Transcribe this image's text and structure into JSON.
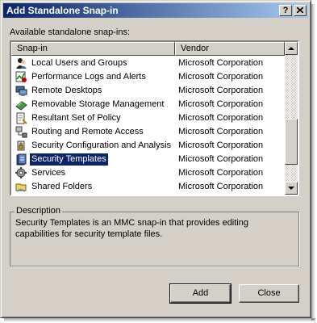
{
  "window": {
    "title": "Add Standalone Snap-in",
    "help_label": "?",
    "close_label": "✕"
  },
  "list": {
    "label": "Available standalone snap-ins:",
    "columns": [
      "Snap-in",
      "Vendor"
    ],
    "items": [
      {
        "name": "Local Users and Groups",
        "vendor": "Microsoft Corporation",
        "icon": "users-icon"
      },
      {
        "name": "Performance Logs and Alerts",
        "vendor": "Microsoft Corporation",
        "icon": "performance-icon"
      },
      {
        "name": "Remote Desktops",
        "vendor": "Microsoft Corporation",
        "icon": "remote-desktop-icon"
      },
      {
        "name": "Removable Storage Management",
        "vendor": "Microsoft Corporation",
        "icon": "removable-storage-icon"
      },
      {
        "name": "Resultant Set of Policy",
        "vendor": "Microsoft Corporation",
        "icon": "policy-icon"
      },
      {
        "name": "Routing and Remote Access",
        "vendor": "Microsoft Corporation",
        "icon": "routing-icon"
      },
      {
        "name": "Security Configuration and Analysis",
        "vendor": "Microsoft Corporation",
        "icon": "security-config-icon"
      },
      {
        "name": "Security Templates",
        "vendor": "Microsoft Corporation",
        "icon": "security-templates-icon",
        "selected": true
      },
      {
        "name": "Services",
        "vendor": "Microsoft Corporation",
        "icon": "services-icon"
      },
      {
        "name": "Shared Folders",
        "vendor": "Microsoft Corporation",
        "icon": "shared-folder-icon"
      }
    ]
  },
  "description": {
    "legend": "Description",
    "text": "Security Templates is an MMC snap-in that provides editing capabilities for security template files."
  },
  "buttons": {
    "add": "Add",
    "close": "Close"
  }
}
